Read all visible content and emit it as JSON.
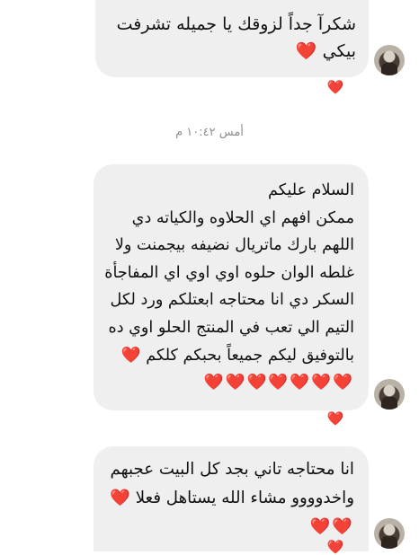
{
  "messages": [
    {
      "lines": [
        "شكرآ جداً لزوقك يا جميله تشرفت",
        "بيكي"
      ],
      "trail": "❤️",
      "reaction": "❤️"
    },
    {
      "lines": [
        "السلام عليكم",
        "ممكن افهم اي الحلاوه والكياته دي",
        "اللهم بارك ماتريال نضيفه بيجمنت ولا",
        "غلطه الوان حلوه اوي اوي اي المفاجأة",
        "السكر دي انا محتاجه ابعتلكم ورد لكل",
        "التيم الي تعب في المنتج الحلو اوي ده",
        "بالتوفيق ليكم جميعاً بحبكم كلكم"
      ],
      "trail": "❤️",
      "hearts": "❤️❤️❤️❤️❤️❤️❤️",
      "reaction": "❤️"
    },
    {
      "lines": [
        "انا محتاجه تاني بجد كل البيت عجبهم",
        "واخدوووو مشاء الله يستاهل فعلا"
      ],
      "trail": "❤️",
      "hearts": "❤️❤️",
      "reaction": "❤️"
    }
  ],
  "timestamp": "أمس ١٠:٤٢ م"
}
